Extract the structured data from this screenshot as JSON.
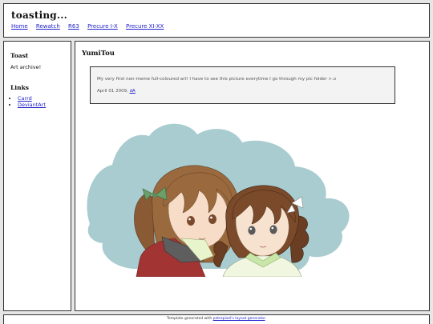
{
  "header": {
    "title": "toasting...",
    "nav": [
      "Home",
      "Rewatch",
      "R63",
      "Precure I-X",
      "Precure XI-XX"
    ]
  },
  "sidebar": {
    "about_heading": "Toast",
    "about_text": "Art archive!",
    "links_heading": "Links",
    "links": [
      "Carrd",
      "DeviantArt"
    ]
  },
  "post": {
    "title": "YumiTou",
    "description": "My very first non-meme full-coloured art! I have to see this picture everytime I go through my pic folder >.o",
    "date": "April 01 2009,",
    "author": "dA"
  },
  "footer": {
    "prefix": "Template generated with",
    "link": "petrapixel's layout generator",
    "suffix": "."
  },
  "colors": {
    "background": "#e6e6e6",
    "link": "#2222cc",
    "art_backdrop": "#a8ccd0"
  }
}
